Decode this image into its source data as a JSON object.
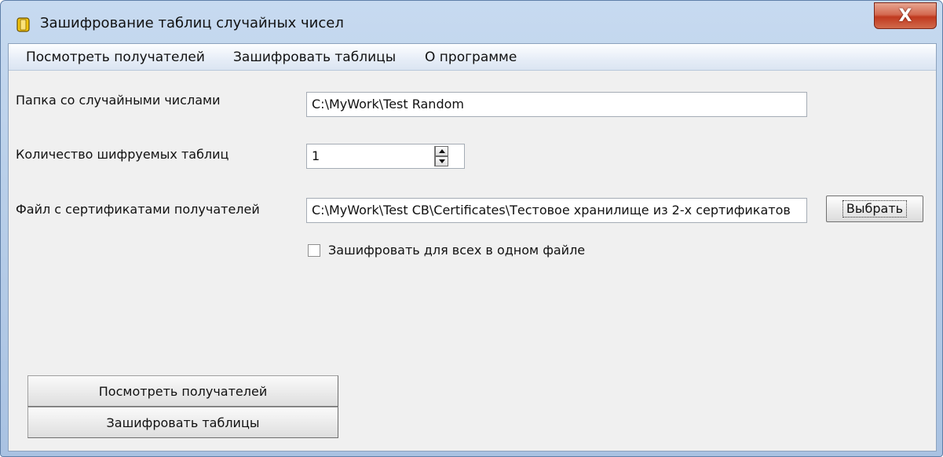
{
  "window": {
    "title": "Зашифрование таблиц случайных чисел",
    "close_glyph": "X"
  },
  "menu": {
    "items": [
      "Посмотреть получателей",
      "Зашифровать таблицы",
      "О программе"
    ]
  },
  "form": {
    "random_folder_label": "Папка со случайными числами",
    "random_folder_value": "C:\\MyWork\\Test Random",
    "table_count_label": "Количество шифруемых таблиц",
    "table_count_value": "1",
    "cert_file_label": "Файл с сертификатами получателей",
    "cert_file_value": "C:\\MyWork\\Test CB\\Certificates\\Тестовое хранилище из 2-х сертификатов",
    "browse_label": "Выбрать",
    "single_file_label": "Зашифровать для всех в одном файле",
    "single_file_checked": false
  },
  "buttons": {
    "view_recipients": "Посмотреть получателей",
    "encrypt_tables": "Зашифровать таблицы"
  },
  "colors": {
    "titlebar": "#b9cfe9",
    "client_bg": "#f0f0f0",
    "close_button": "#c0391f",
    "app_icon": "#f2c40f"
  },
  "icons": {
    "app": "app-icon",
    "close": "close-icon"
  }
}
